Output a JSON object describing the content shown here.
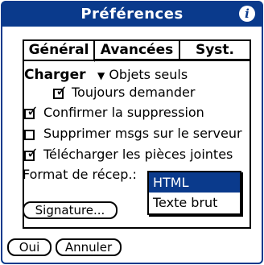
{
  "window": {
    "title": "Préférences",
    "info_icon": "info-icon"
  },
  "tabs": [
    {
      "label": "Général",
      "active": true
    },
    {
      "label": "Avancées",
      "active": false
    },
    {
      "label": "Syst.",
      "active": false
    }
  ],
  "charger": {
    "label": "Charger",
    "value": "Objets seuls"
  },
  "options": {
    "toujours_demander": {
      "label": "Toujours demander",
      "checked": true
    },
    "confirmer": {
      "label": "Confirmer la suppression",
      "checked": true
    },
    "supprimer_serveur": {
      "label": "Supprimer msgs sur le serveur",
      "checked": false
    },
    "telecharger": {
      "label": "Télécharger les pièces jointes",
      "checked": true
    }
  },
  "format": {
    "label": "Format de récep.:",
    "options": [
      "HTML",
      "Texte brut"
    ],
    "selected": "HTML"
  },
  "buttons": {
    "signature": "Signature...",
    "ok": "Oui",
    "cancel": "Annuler"
  },
  "colors": {
    "accent": "#0a3a8c"
  }
}
